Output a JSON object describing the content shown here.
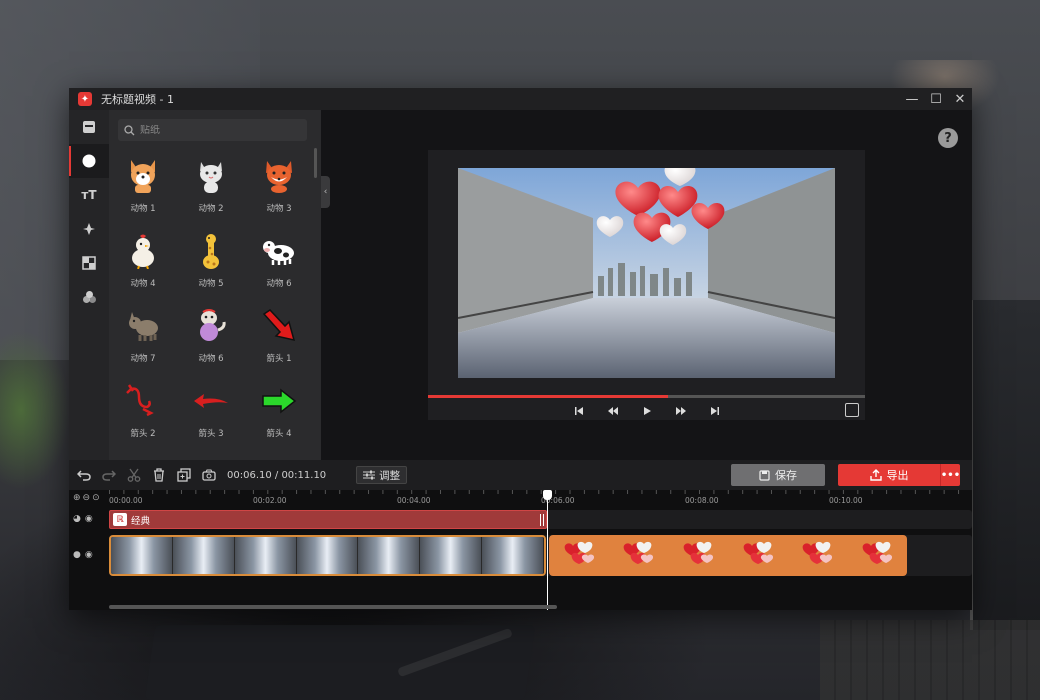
{
  "window": {
    "title": "无标题视频 - 1"
  },
  "window_controls": {
    "minimize": "—",
    "maximize": "☐",
    "close": "✕"
  },
  "sidebar": {
    "items": [
      {
        "name": "media-icon"
      },
      {
        "name": "sticker-icon",
        "active": true
      },
      {
        "name": "text-icon",
        "label": "тT"
      },
      {
        "name": "effects-icon"
      },
      {
        "name": "transition-icon"
      },
      {
        "name": "filter-icon"
      }
    ]
  },
  "sticker_panel": {
    "search_placeholder": "贴纸",
    "items": [
      {
        "label": "动物 1",
        "icon": "corgi"
      },
      {
        "label": "动物 2",
        "icon": "cat"
      },
      {
        "label": "动物 3",
        "icon": "fox"
      },
      {
        "label": "动物 4",
        "icon": "chicken"
      },
      {
        "label": "动物 5",
        "icon": "giraffe"
      },
      {
        "label": "动物 6",
        "icon": "cow"
      },
      {
        "label": "动物 7",
        "icon": "donkey"
      },
      {
        "label": "动物 6",
        "icon": "monkey"
      },
      {
        "label": "箭头 1",
        "icon": "red-arrow-down"
      },
      {
        "label": "箭头 2",
        "icon": "red-curly-arrow"
      },
      {
        "label": "箭头 3",
        "icon": "red-arrow-left"
      },
      {
        "label": "箭头 4",
        "icon": "green-arrow-right"
      }
    ]
  },
  "preview": {
    "help_label": "?",
    "progress": 0.55
  },
  "toolbar": {
    "timecode": "00:06.10 / 00:11.10",
    "adjust_label": "调整",
    "save_label": "保存",
    "export_label": "导出",
    "more_label": "•••"
  },
  "timeline": {
    "ticks": [
      "00:00.00",
      "00:02.00",
      "00:04.00",
      "00:06.00",
      "00:08.00",
      "00:10.00"
    ],
    "filter_clip": {
      "tag": "ℝ",
      "label": "经典"
    },
    "sticker_clip_count": 6
  },
  "colors": {
    "accent": "#e53935",
    "clip_orange": "#e0823e",
    "filter_clip": "#a03a3a"
  }
}
